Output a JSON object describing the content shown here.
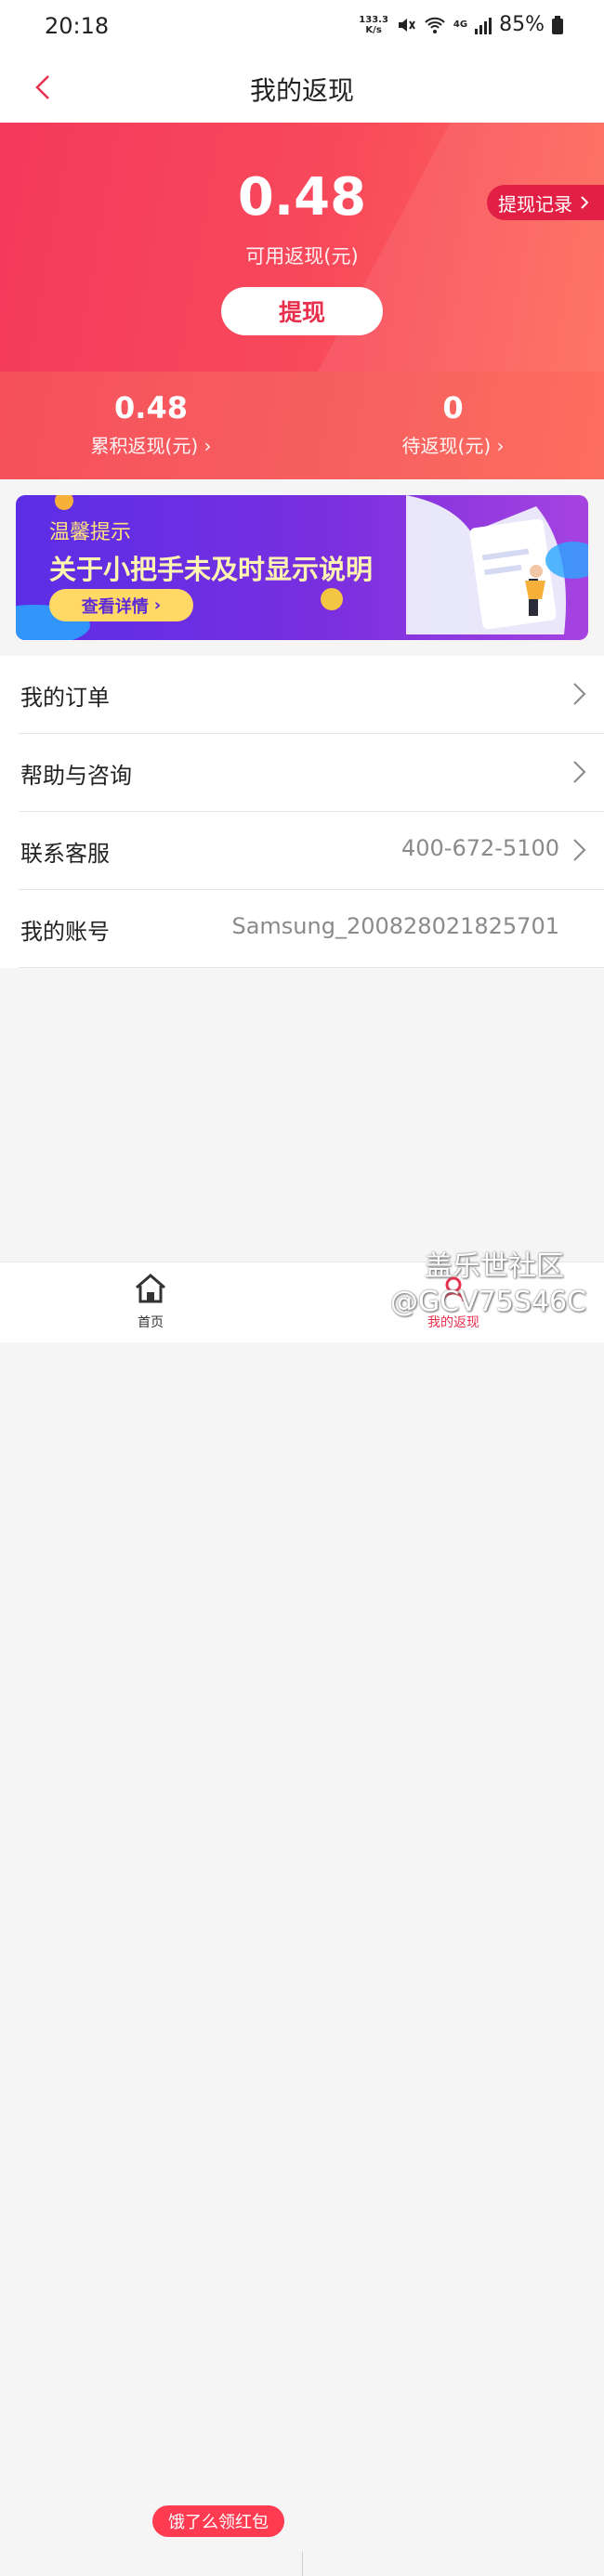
{
  "status_bar": {
    "time": "20:18",
    "speed_value": "133.3",
    "speed_unit": "K/s",
    "battery": "85%",
    "network": "4G"
  },
  "header": {
    "title": "我的返现"
  },
  "hero": {
    "amount": "0.48",
    "amount_label": "可用返现(元)",
    "withdraw_label": "提现",
    "records_label": "提现记录"
  },
  "stats": [
    {
      "value": "0.48",
      "label": "累积返现(元)"
    },
    {
      "value": "0",
      "label": "待返现(元)"
    }
  ],
  "banner": {
    "title": "温馨提示",
    "headline": "关于小把手未及时显示说明",
    "button": "查看详情"
  },
  "menu": [
    {
      "label": "我的订单",
      "value": ""
    },
    {
      "label": "帮助与咨询",
      "value": ""
    },
    {
      "label": "联系客服",
      "value": "400-672-5100"
    },
    {
      "label": "我的账号",
      "value": "Samsung_200828021825701"
    }
  ],
  "tabbar": {
    "home": "首页",
    "cashback": "我的返现",
    "promo": "饿了么领红包"
  },
  "watermark": {
    "line1": "盖乐世社区",
    "line2": "@GCV75S46C"
  },
  "colors": {
    "accent": "#f4395c",
    "banner_bg": "#6a2fe3",
    "button_yellow": "#ffd865"
  }
}
